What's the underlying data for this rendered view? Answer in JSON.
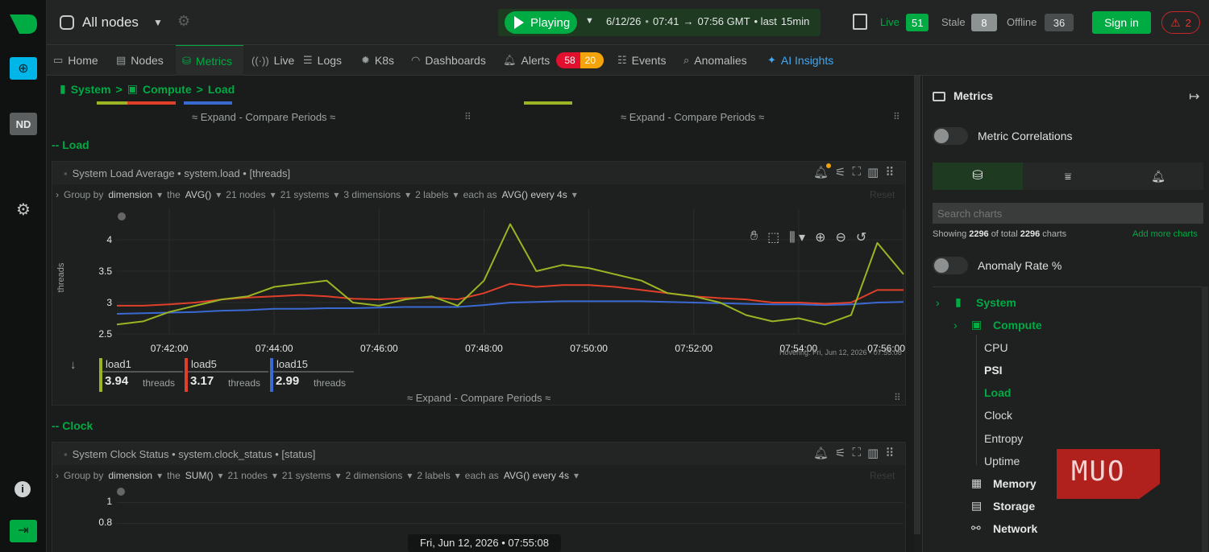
{
  "topbar": {
    "scope": "All nodes",
    "play_label": "Playing",
    "time_date": "6/12/26",
    "time_from": "07:41",
    "time_arrow": "→",
    "time_to": "07:56 GMT",
    "time_sep": "• last",
    "time_last": "15min",
    "live_label": "Live",
    "live_count": "51",
    "stale_label": "Stale",
    "stale_count": "8",
    "offline_label": "Offline",
    "offline_count": "36",
    "signin_label": "Sign in",
    "alert_count": "2"
  },
  "leftbar": {
    "node_badge": "ND"
  },
  "tabs": [
    {
      "label": "Home"
    },
    {
      "label": "Nodes"
    },
    {
      "label": "Metrics"
    },
    {
      "label": "Live"
    },
    {
      "label": "Logs"
    },
    {
      "label": "K8s"
    },
    {
      "label": "Dashboards"
    },
    {
      "label": "Alerts"
    },
    {
      "label": "Events"
    },
    {
      "label": "Anomalies"
    },
    {
      "label": "AI Insights"
    }
  ],
  "alerts": {
    "critical": "58",
    "warning": "20"
  },
  "breadcrumb": {
    "system": "System",
    "sep1": ">",
    "compute": "Compute",
    "sep2": ">",
    "load": "Load"
  },
  "content": {
    "expand_label": "Expand - Compare Periods",
    "section_load": "-- Load",
    "section_clock": "-- Clock",
    "load_chart": {
      "title": "System Load Average • system.load • [threads]",
      "gb_prefix": "Group by",
      "gb_dimension": "dimension",
      "gb_the": "the",
      "gb_agg": "AVG()",
      "gb_nodes": "21 nodes",
      "gb_systems": "21 systems",
      "gb_dimensions": "3 dimensions",
      "gb_labels": "2 labels",
      "gb_each": "each as",
      "gb_each_agg": "AVG() every 4s",
      "reset": "Reset",
      "hovering": "Hovering: Fri, Jun 12, 2026 • 07:55:08"
    },
    "clock_chart": {
      "title": "System Clock Status • system.clock_status • [status]",
      "gb_prefix": "Group by",
      "gb_dimension": "dimension",
      "gb_the": "the",
      "gb_agg": "SUM()",
      "gb_nodes": "21 nodes",
      "gb_systems": "21 systems",
      "gb_dimensions": "2 dimensions",
      "gb_labels": "2 labels",
      "gb_each": "each as",
      "gb_each_agg": "AVG() every 4s",
      "reset": "Reset",
      "y_ticks": [
        "1",
        "0.8"
      ]
    },
    "bottom_time": "Fri, Jun 12, 2026 • 07:55:08"
  },
  "right": {
    "title": "Metrics",
    "metric_correlations": "Metric Correlations",
    "search_placeholder": "Search charts",
    "showing_prefix": "Showing",
    "showing_count": "2296",
    "showing_mid": "of total",
    "showing_total": "2296",
    "showing_suffix": "charts",
    "add_more": "Add more charts",
    "anomaly_rate": "Anomaly Rate %",
    "tree": {
      "system": "System",
      "compute": "Compute",
      "cpu": "CPU",
      "psi": "PSI",
      "load": "Load",
      "clock": "Clock",
      "entropy": "Entropy",
      "uptime": "Uptime",
      "memory": "Memory",
      "storage": "Storage",
      "network": "Network"
    },
    "watermark": "MUO"
  },
  "colors": {
    "accent": "#00ab44",
    "load1": "#9ab424",
    "load5": "#e0402a",
    "load15": "#3b69d4",
    "critical": "#e2102f",
    "warning": "#f5a30a"
  },
  "chart_data": {
    "type": "line",
    "ylabel": "threads",
    "ylim": [
      2.5,
      4.5
    ],
    "y_ticks": [
      "4",
      "3.5",
      "3",
      "2.5"
    ],
    "x_ticks": [
      "07:42:00",
      "07:44:00",
      "07:46:00",
      "07:48:00",
      "07:50:00",
      "07:52:00",
      "07:54:00",
      "07:56:00"
    ],
    "x_minutes": [
      0,
      1,
      2,
      3,
      4,
      5,
      6,
      7,
      8,
      9,
      10,
      11,
      12,
      13,
      14,
      15,
      16,
      17,
      18,
      19,
      20,
      21,
      22,
      23,
      24,
      25,
      26,
      27,
      28,
      29,
      30
    ],
    "series": [
      {
        "name": "load1",
        "value": "3.94",
        "unit": "threads",
        "values": [
          2.65,
          2.7,
          2.85,
          2.95,
          3.05,
          3.1,
          3.25,
          3.3,
          3.35,
          3.0,
          2.95,
          3.05,
          3.1,
          2.95,
          3.35,
          4.25,
          3.5,
          3.6,
          3.55,
          3.45,
          3.35,
          3.15,
          3.1,
          3.0,
          2.8,
          2.7,
          2.75,
          2.65,
          2.8,
          3.95,
          3.45
        ]
      },
      {
        "name": "load5",
        "value": "3.17",
        "unit": "threads",
        "values": [
          2.95,
          2.95,
          2.97,
          3.0,
          3.05,
          3.08,
          3.1,
          3.12,
          3.1,
          3.06,
          3.05,
          3.07,
          3.08,
          3.05,
          3.15,
          3.3,
          3.25,
          3.28,
          3.28,
          3.25,
          3.2,
          3.15,
          3.1,
          3.07,
          3.05,
          3.0,
          3.0,
          2.98,
          3.0,
          3.2,
          3.2
        ]
      },
      {
        "name": "load15",
        "value": "2.99",
        "unit": "threads",
        "values": [
          2.82,
          2.83,
          2.84,
          2.85,
          2.87,
          2.88,
          2.9,
          2.9,
          2.91,
          2.91,
          2.92,
          2.93,
          2.93,
          2.93,
          2.96,
          3.0,
          3.01,
          3.02,
          3.02,
          3.02,
          3.02,
          3.01,
          3.0,
          2.99,
          2.98,
          2.97,
          2.97,
          2.96,
          2.97,
          3.0,
          3.01
        ]
      }
    ]
  }
}
